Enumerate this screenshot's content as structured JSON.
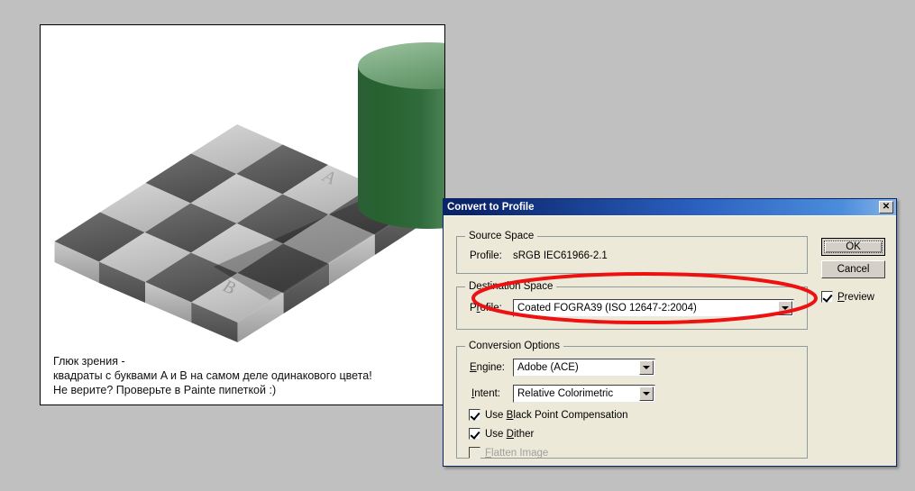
{
  "desktop": {
    "background_color": "#c0c0c0"
  },
  "image_panel": {
    "name": "checker-shadow-illusion",
    "background_color": "#ffffff",
    "border_color": "#000000",
    "cylinder_color": "#2f6b3c",
    "cylinder_top_color": "#7fa984",
    "caption": {
      "line1": "Глюк зрения -",
      "line2": "квадраты с буквами A и B на самом деле одинакового цвета!",
      "line3": "Не верите? Проверьте в Painte пипеткой :)"
    },
    "checker_labels": {
      "a": "A",
      "b": "B"
    }
  },
  "dialog": {
    "title": "Convert to Profile",
    "close_label": "✕",
    "source_space": {
      "group_label": "Source Space",
      "profile_label": "Profile:",
      "profile_value": "sRGB IEC61966-2.1"
    },
    "destination_space": {
      "group_label": "Destination Space",
      "profile_label_pre": "P",
      "profile_label_accel": "r",
      "profile_label_post": "ofile:",
      "profile_value": "Coated FOGRA39 (ISO 12647-2:2004)"
    },
    "conversion_options": {
      "group_label": "Conversion Options",
      "engine_label_pre": "",
      "engine_label_accel": "E",
      "engine_label_post": "ngine:",
      "engine_value": "Adobe (ACE)",
      "intent_label_pre": "",
      "intent_label_accel": "I",
      "intent_label_post": "ntent:",
      "intent_value": "Relative Colorimetric",
      "black_point_pre": "Use ",
      "black_point_accel": "B",
      "black_point_post": "lack Point Compensation",
      "black_point_checked": true,
      "dither_pre": "Use ",
      "dither_accel": "D",
      "dither_post": "ither",
      "dither_checked": true,
      "flatten_pre": "",
      "flatten_accel": "F",
      "flatten_post": "latten Image",
      "flatten_checked": false,
      "flatten_disabled": true
    },
    "buttons": {
      "ok_label": "OK",
      "cancel_label": "Cancel"
    },
    "preview": {
      "label_pre": "",
      "label_accel": "P",
      "label_post": "review",
      "checked": true
    }
  },
  "annotation": {
    "shape": "ellipse",
    "color": "#ee1111",
    "stroke_width": 4,
    "targets": "destination-space-profile-dropdown"
  }
}
